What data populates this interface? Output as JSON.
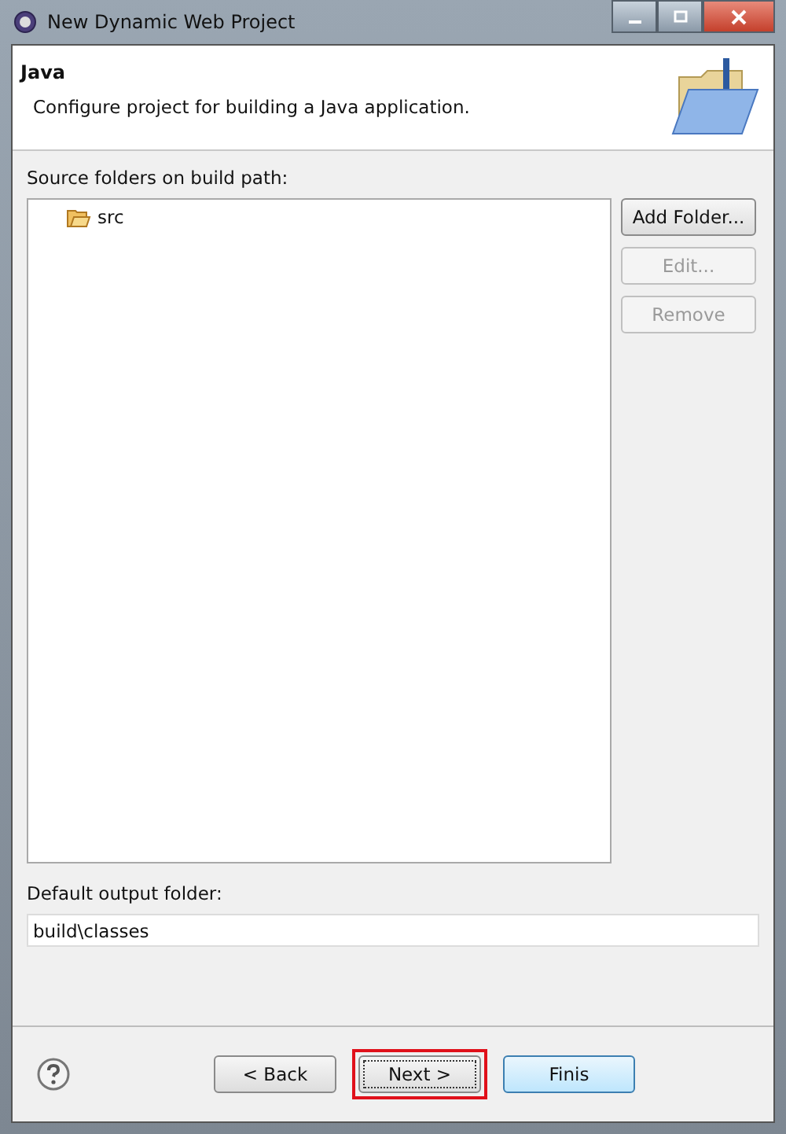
{
  "window": {
    "title": "New Dynamic Web Project"
  },
  "header": {
    "title": "Java",
    "description": "Configure project for building a Java application."
  },
  "source_folders": {
    "label": "Source folders on build path:",
    "items": [
      {
        "name": "src",
        "selected": false
      }
    ]
  },
  "side_buttons": [
    {
      "label": "Add Folder...",
      "disabled": false
    },
    {
      "label": "Edit...",
      "disabled": true
    },
    {
      "label": "Remove",
      "disabled": true
    }
  ],
  "output": {
    "label": "Default output folder:",
    "value": "build\\classes"
  },
  "footer_buttons": [
    {
      "label": "< Back",
      "kind": "normal",
      "highlighted": false
    },
    {
      "label": "Next >",
      "kind": "focused",
      "highlighted": true
    },
    {
      "label": "Finis",
      "kind": "default",
      "highlighted": false
    }
  ]
}
